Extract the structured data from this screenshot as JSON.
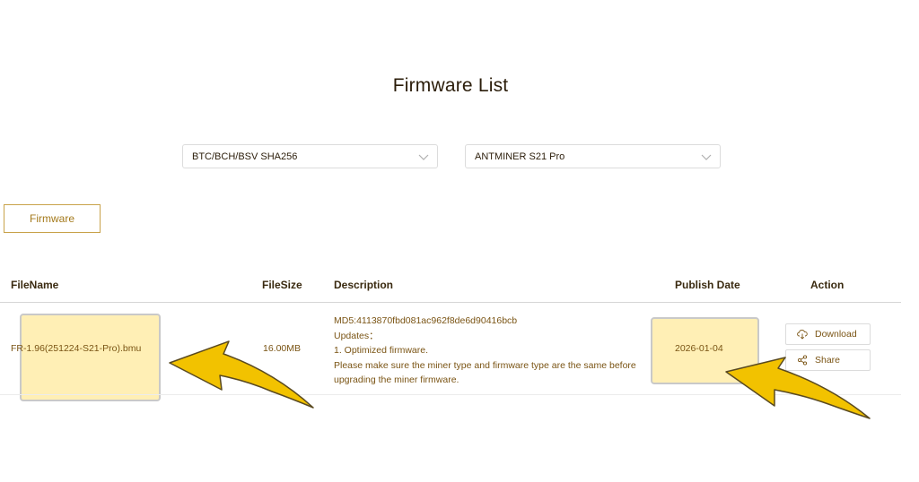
{
  "page": {
    "title": "Firmware List"
  },
  "filters": {
    "algorithm": {
      "value": "BTC/BCH/BSV SHA256",
      "icon": "chevron-down-icon"
    },
    "model": {
      "value": "ANTMINER S21 Pro",
      "icon": "chevron-down-icon"
    }
  },
  "tabs": {
    "firmware": "Firmware"
  },
  "table": {
    "headers": {
      "filename": "FileName",
      "filesize": "FileSize",
      "description": "Description",
      "publish_date": "Publish Date",
      "action": "Action"
    },
    "rows": [
      {
        "filename": "FR-1.96(251224-S21-Pro).bmu",
        "filesize": "16.00MB",
        "description": [
          "MD5:4113870fbd081ac962f8de6d90416bcb",
          "Updates：",
          "1. Optimized firmware.",
          "Please make sure the miner type and firmware type are the same before",
          "upgrading the miner firmware."
        ],
        "publish_date": "2026-01-04",
        "actions": {
          "download": "Download",
          "share": "Share"
        }
      }
    ]
  },
  "annotations": {
    "highlight_color": "#FFEAA0",
    "arrow_color": "#F2C200"
  }
}
